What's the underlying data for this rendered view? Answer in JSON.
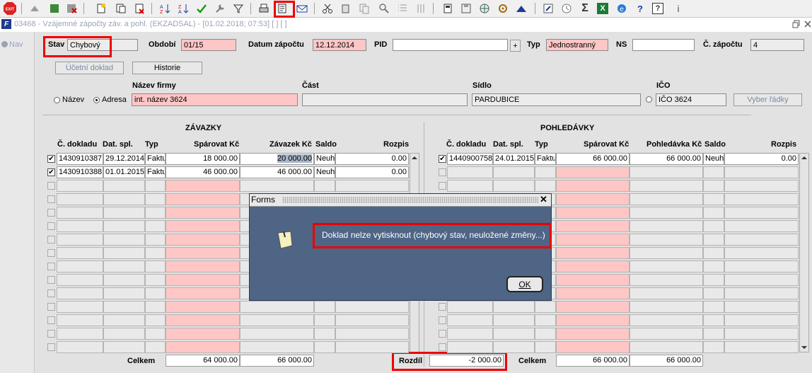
{
  "toolbar": {
    "exit_label": "EXIT",
    "icons": [
      "exit-icon",
      "back-icon",
      "record-icon",
      "delete-record-icon",
      "new-icon",
      "copy-icon",
      "remove-icon",
      "sort-asc-icon",
      "sort-desc-icon",
      "confirm-icon",
      "tools-icon",
      "filter-icon",
      "print-icon",
      "print-preview-icon",
      "mail-icon",
      "cut-icon",
      "paste-icon",
      "copy-doc-icon",
      "find-icon",
      "list-icon",
      "columns-icon",
      "calc-icon",
      "save-icon",
      "globe-icon",
      "settings-icon",
      "up-icon",
      "edit-icon",
      "clock-icon",
      "sum-icon",
      "excel-icon",
      "ie-icon",
      "help-icon",
      "whatsnew-icon",
      "info-icon"
    ],
    "sum_symbol": "Σ",
    "excel_symbol": "X",
    "help_symbol": "?",
    "info_symbol": "i"
  },
  "window": {
    "title": "03468 - Vzájemné zápočty záv. a pohl. (EKZADSAL) - [01.02.2018; 07:53]  [ ]  [ ]",
    "app_icon": "F"
  },
  "left_nav": {
    "label": "Nav"
  },
  "header": {
    "stav_label": "Stav",
    "stav_value": "Chybový",
    "obdobi_label": "Období",
    "obdobi_value": "01/15",
    "datum_label": "Datum zápočtu",
    "datum_value": "12.12.2014",
    "pid_label": "PID",
    "pid_value": "",
    "plus_label": "+",
    "typ_label": "Typ",
    "typ_value": "Jednostranný",
    "ns_label": "NS",
    "ns_value": "",
    "cislo_label": "Č. zápočtu",
    "cislo_value": "4",
    "ucetni_btn": "Účetní doklad",
    "historie_btn": "Historie"
  },
  "firm": {
    "nazev_firmy_label": "Název firmy",
    "cast_label": "Část",
    "sidlo_label": "Sídlo",
    "ico_label": "IČO",
    "radio_nazev": "Název",
    "radio_adresa": "Adresa",
    "nazev_value": "int. název 3624",
    "cast_value": "",
    "sidlo_value": "PARDUBICE",
    "ico_value": "IČO 3624",
    "vyber_btn": "Vyber řádky"
  },
  "zavazky": {
    "title": "ZÁVAZKY",
    "columns": [
      "Č. dokladu",
      "Dat. spl.",
      "Typ",
      "Spárovat Kč",
      "Závazek Kč",
      "Saldo",
      "Rozpis"
    ],
    "rows": [
      {
        "doc": "1430910387",
        "date": "29.12.2014",
        "typ": "Faktu",
        "sparovat": "18 000.00",
        "zavazek": "20 000.00",
        "saldo": "Neuh",
        "rozpis": "0.00"
      },
      {
        "doc": "1430910388",
        "date": "01.01.2015",
        "typ": "Faktu",
        "sparovat": "46 000.00",
        "zavazek": "46 000.00",
        "saldo": "Neuh",
        "rozpis": "0.00"
      }
    ],
    "celkem_label": "Celkem",
    "celkem_sparovat": "64 000.00",
    "celkem_zavazek": "66 000.00"
  },
  "pohledavky": {
    "title": "POHLEDÁVKY",
    "columns": [
      "Č. dokladu",
      "Dat. spl.",
      "Typ",
      "Spárovat Kč",
      "Pohledávka Kč",
      "Saldo",
      "Rozpis"
    ],
    "rows": [
      {
        "doc": "1440900758",
        "date": "24.01.2015",
        "typ": "Faktu",
        "sparovat": "66 000.00",
        "pohledavka": "66 000.00",
        "saldo": "Neuh",
        "rozpis": "0.00"
      }
    ],
    "celkem_label": "Celkem",
    "celkem_sparovat": "66 000.00",
    "celkem_pohledavka": "66 000.00"
  },
  "rozdil": {
    "label": "Rozdíl",
    "value": "-2 000.00"
  },
  "dialog": {
    "title": "Forms",
    "message": "Doklad nelze vytisknout (chybový stav, neuložené změny...)",
    "ok_label": "OK",
    "close_symbol": "✕"
  },
  "colors": {
    "highlight": "#e00000",
    "pink_field": "#ffc6c6",
    "dialog_bg": "#4e6585",
    "form_bg": "#e2e2e2"
  }
}
